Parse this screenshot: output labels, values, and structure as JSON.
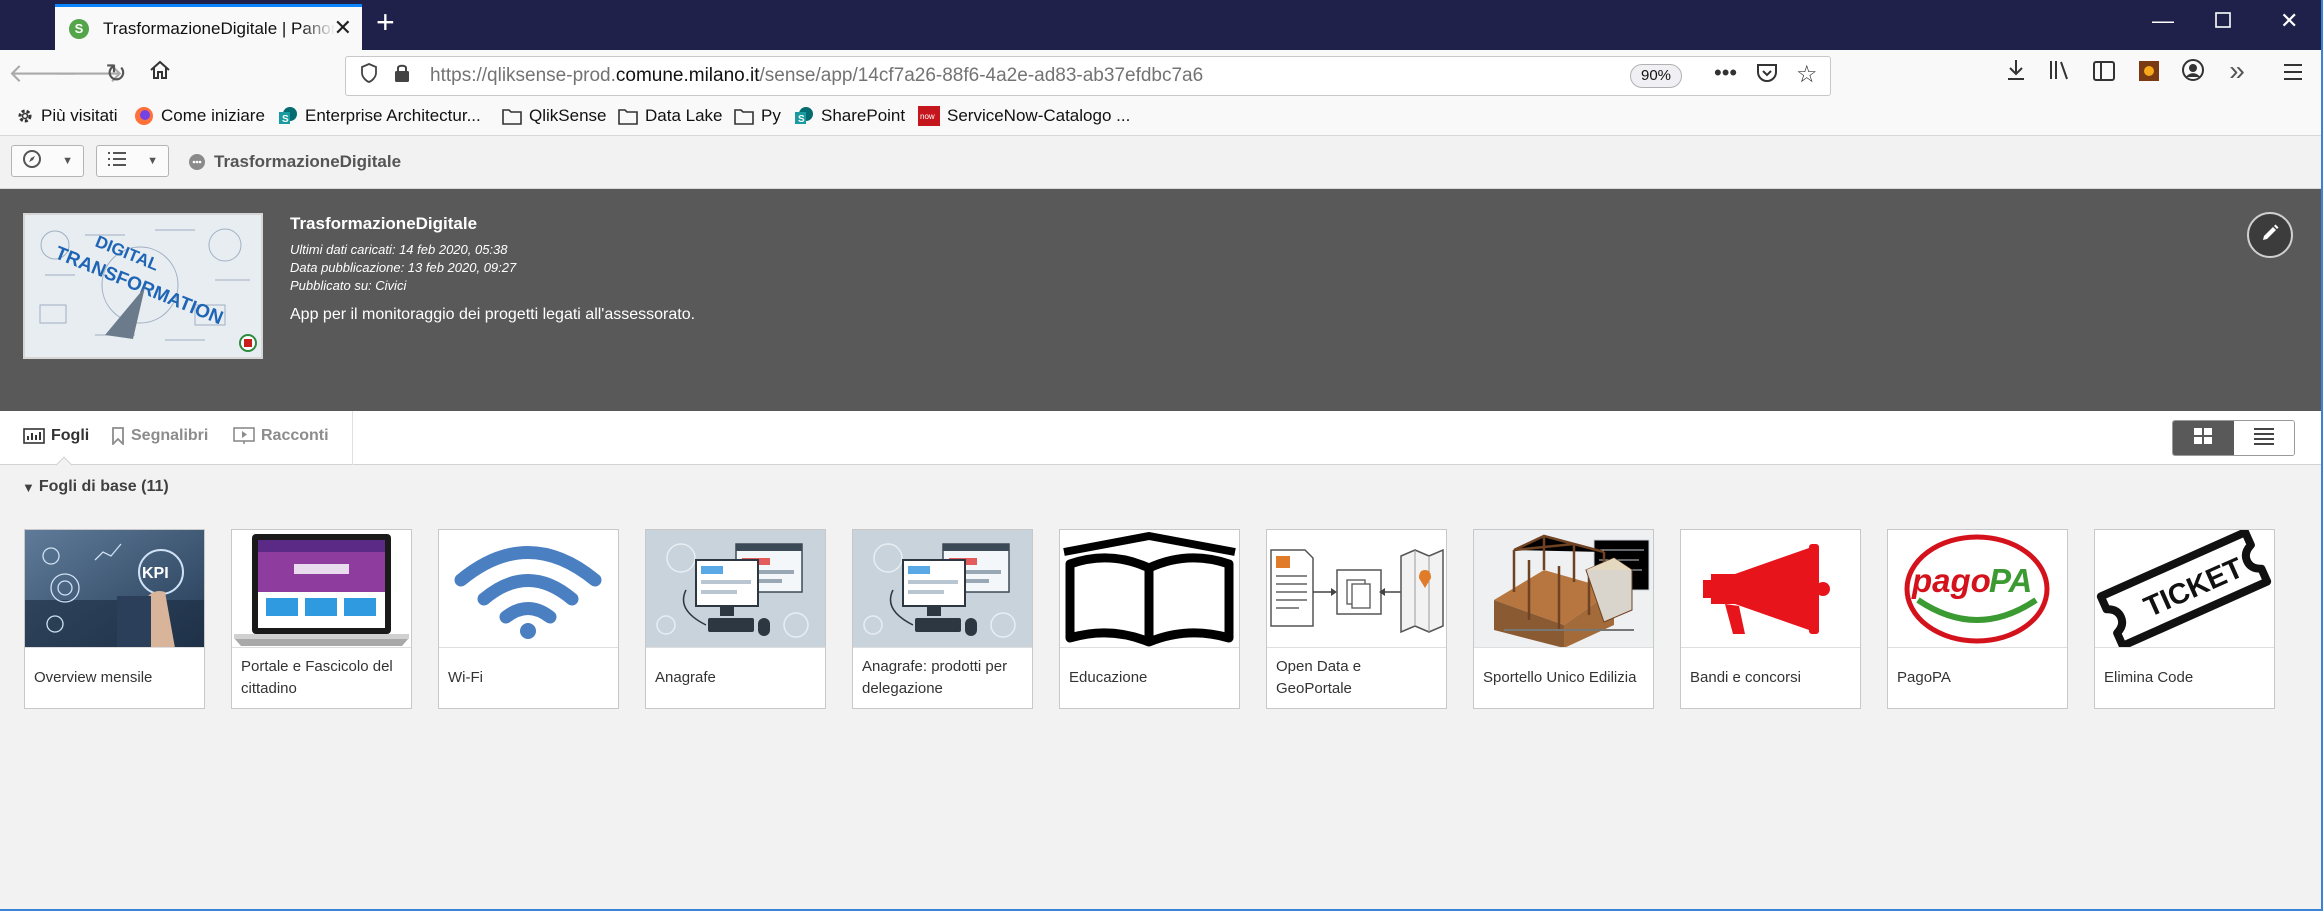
{
  "browser": {
    "tab_title": "TrasformazioneDigitale | Panoramica app",
    "url_prefix": "https://qliksense-prod.",
    "url_domain": "comune.milano.it",
    "url_path": "/sense/app/14cf7a26-88f6-4a2e-ad83-ab37efdbc7a6",
    "zoom": "90%",
    "bookmarks": [
      {
        "label": "Più visitati",
        "icon": "gear-icon"
      },
      {
        "label": "Come iniziare",
        "icon": "firefox-icon"
      },
      {
        "label": "Enterprise Architectur...",
        "icon": "sharepoint-icon"
      },
      {
        "label": "QlikSense",
        "icon": "folder-icon"
      },
      {
        "label": "Data Lake",
        "icon": "folder-icon"
      },
      {
        "label": "Py",
        "icon": "folder-icon"
      },
      {
        "label": "SharePoint",
        "icon": "sharepoint-icon"
      },
      {
        "label": "ServiceNow-Catalogo ...",
        "icon": "servicenow-icon"
      }
    ]
  },
  "qlik_toolbar": {
    "app_name": "TrasformazioneDigitale"
  },
  "app": {
    "title": "TrasformazioneDigitale",
    "last_loaded": "Ultimi dati caricati: 14 feb 2020, 05:38",
    "published_date": "Data pubblicazione: 13 feb 2020, 09:27",
    "published_on": "Pubblicato su: Civici",
    "description": "App per il monitoraggio dei progetti legati all'assessorato.",
    "thumbnail_text": "DIGITAL TRANSFORMATION"
  },
  "content_tabs": {
    "sheets": "Fogli",
    "bookmarks": "Segnalibri",
    "stories": "Racconti"
  },
  "section": {
    "title": "Fogli di base (11)"
  },
  "sheets": [
    {
      "label": "Overview mensile",
      "icon": "kpi-image"
    },
    {
      "label": "Portale e Fascicolo del cittadino",
      "icon": "laptop-image"
    },
    {
      "label": "Wi-Fi",
      "icon": "wifi-image"
    },
    {
      "label": "Anagrafe",
      "icon": "computer-registry-image"
    },
    {
      "label": "Anagrafe: prodotti per delegazione",
      "icon": "computer-registry-image"
    },
    {
      "label": "Educazione",
      "icon": "open-book-image"
    },
    {
      "label": "Open Data e GeoPortale",
      "icon": "documents-map-image"
    },
    {
      "label": "Sportello Unico Edilizia",
      "icon": "building-frame-image"
    },
    {
      "label": "Bandi e concorsi",
      "icon": "megaphone-image"
    },
    {
      "label": "PagoPA",
      "icon": "pagopa-logo"
    },
    {
      "label": "Elimina Code",
      "icon": "ticket-image"
    }
  ],
  "colors": {
    "tabbar": "#20214b",
    "header": "#595959",
    "wifi": "#4a7fc1",
    "megaphone": "#e8141c",
    "pagopa_red": "#d4121c",
    "pagopa_green": "#3c9a33"
  }
}
